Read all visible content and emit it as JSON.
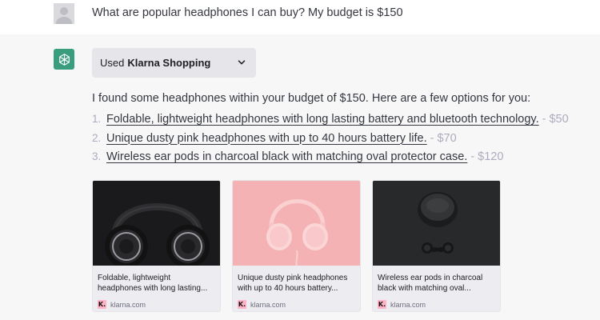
{
  "user_message": {
    "text": "What are popular headphones I can buy? My budget is $150"
  },
  "assistant": {
    "plugin": {
      "used_label": "Used",
      "name": "Klarna Shopping"
    },
    "intro": "I found some headphones within your budget of $150. Here are a few options for you:",
    "options": [
      {
        "num": "1.",
        "title": "Foldable, lightweight headphones with long lasting battery and bluetooth technology.",
        "sep": "-",
        "price": "$50"
      },
      {
        "num": "2.",
        "title": "Unique dusty pink headphones with up to 40 hours battery life.",
        "sep": "-",
        "price": "$70"
      },
      {
        "num": "3.",
        "title": "Wireless ear pods in charcoal black with matching oval protector case.",
        "sep": "-",
        "price": "$120"
      }
    ],
    "cards": [
      {
        "desc": "Foldable, lightweight headphones with long lasting...",
        "logo": "K.",
        "source": "klarna.com",
        "image": "black over-ear headphones"
      },
      {
        "desc": "Unique dusty pink headphones with up to 40 hours battery...",
        "logo": "K.",
        "source": "klarna.com",
        "image": "pink headphones on pink background"
      },
      {
        "desc": "Wireless ear pods in charcoal black with matching oval...",
        "logo": "K.",
        "source": "klarna.com",
        "image": "black earbuds with case"
      }
    ]
  },
  "colors": {
    "assistant_avatar": "#3a9e7e",
    "klarna_pink": "#ffb3c7",
    "background": "#f7f7f8"
  },
  "icons": {
    "user_avatar": "user-avatar-icon",
    "assistant_avatar": "openai-logo-icon",
    "plugin_toggle": "chevron-down-icon"
  }
}
